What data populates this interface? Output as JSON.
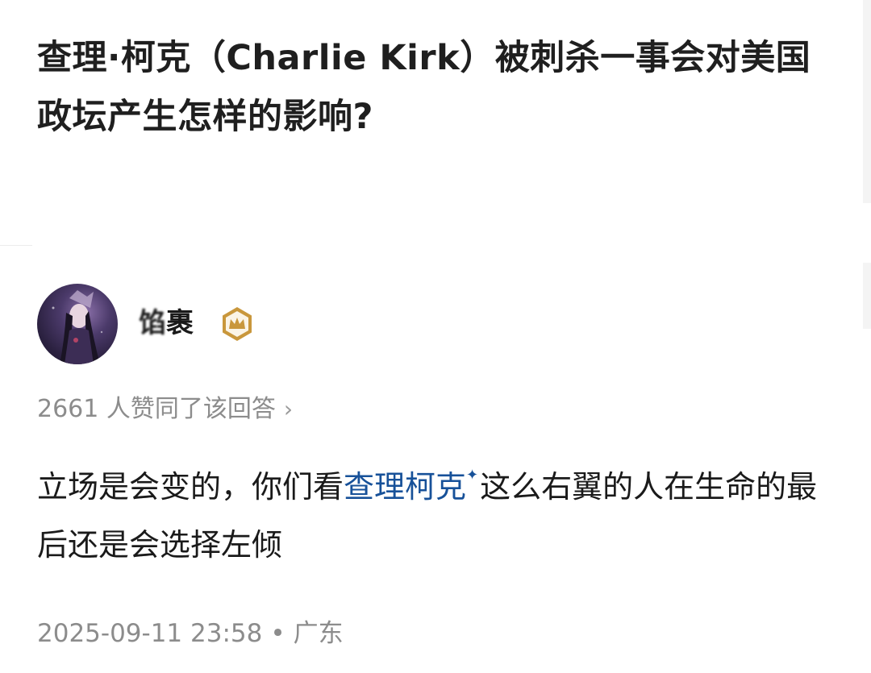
{
  "question": {
    "title": "查理·柯克（Charlie Kirk）被刺杀一事会对美国政坛产生怎样的影响?"
  },
  "answer": {
    "author": {
      "name_blurred": "馅",
      "name_rest": "裹",
      "badge_icon": "crown-badge-icon",
      "badge_color": "#c9973c"
    },
    "vote_text": "2661 人赞同了该回答",
    "vote_chevron": "›",
    "body_prefix": "立场是会变的，你们看",
    "body_link": "查理柯克",
    "body_link_icon": "✦",
    "body_suffix": "这么右翼的人在生命的最后还是会选择左倾",
    "link_color": "#175199",
    "timestamp": "2025-09-11 23:58",
    "separator": "•",
    "location": "广东"
  }
}
